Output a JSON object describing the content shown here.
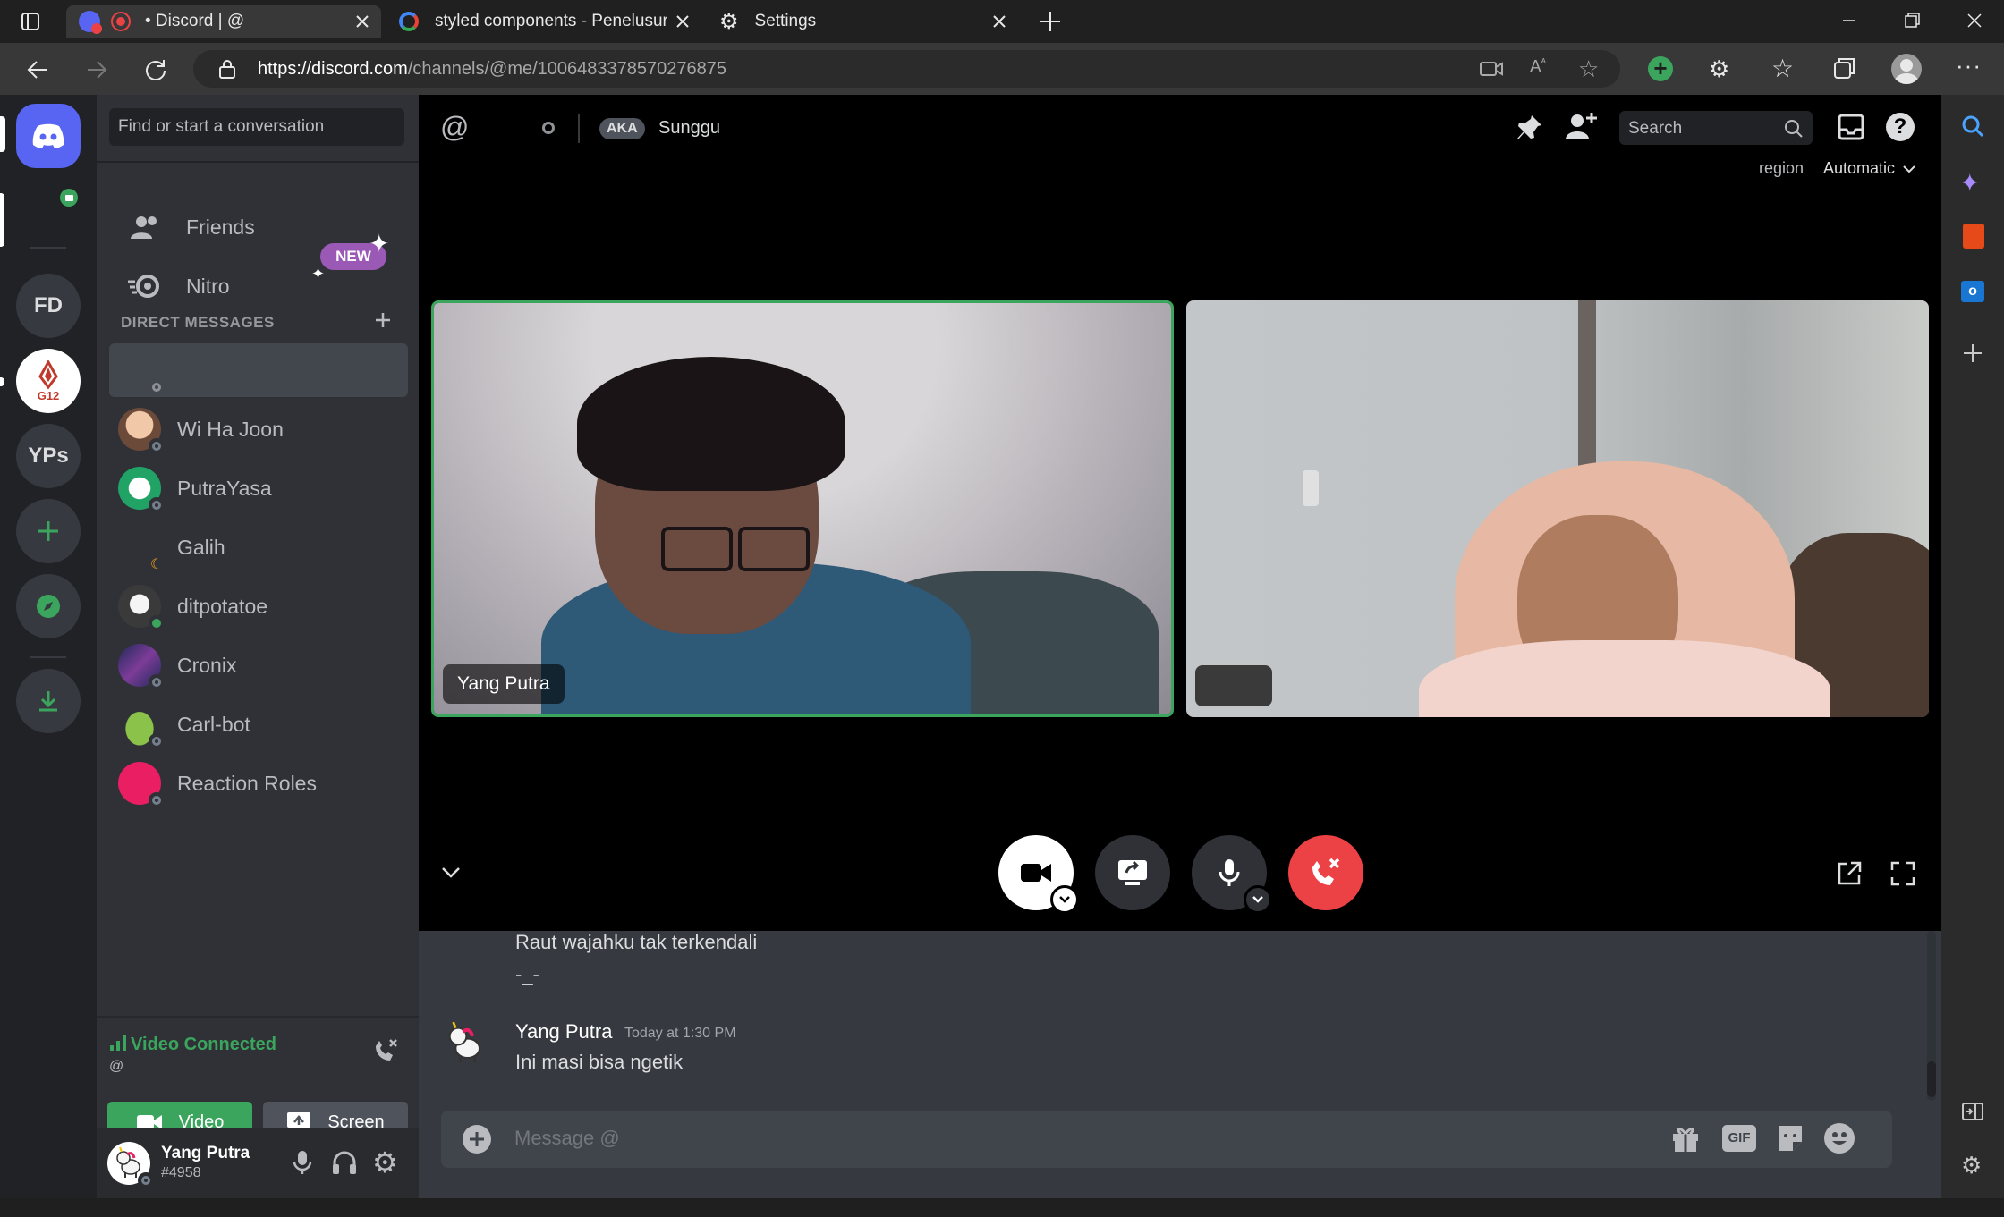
{
  "browser": {
    "tabs": [
      {
        "label": "• Discord | @",
        "active": true
      },
      {
        "label": "styled components - Penelusuran",
        "active": false
      },
      {
        "label": "Settings",
        "active": false
      }
    ],
    "url_host": "https://discord.com",
    "url_path": "/channels/@me/1006483378570276875"
  },
  "guilds": {
    "items": [
      {
        "label": "FD"
      },
      {
        "label": "G12"
      },
      {
        "label": "YPs"
      }
    ]
  },
  "dm": {
    "search_placeholder": "Find or start a conversation",
    "friends": "Friends",
    "nitro": "Nitro",
    "nitro_badge": "NEW",
    "header": "DIRECT MESSAGES",
    "items": [
      {
        "name": ""
      },
      {
        "name": "Wi Ha Joon"
      },
      {
        "name": "PutraYasa"
      },
      {
        "name": "Galih"
      },
      {
        "name": "ditpotatoe"
      },
      {
        "name": "Cronix"
      },
      {
        "name": "Carl-bot"
      },
      {
        "name": "Reaction Roles"
      }
    ]
  },
  "voice": {
    "status": "Video Connected",
    "channel": "@",
    "video_label": "Video",
    "screen_label": "Screen"
  },
  "user": {
    "name": "Yang Putra",
    "tag": "#4958"
  },
  "call": {
    "aka_badge": "AKA",
    "aka_name": "Sunggu",
    "search_placeholder": "Search",
    "region_label": "region",
    "region_value": "Automatic",
    "tile1_name": "Yang Putra",
    "tile2_name": ""
  },
  "chat": {
    "prev_lines": [
      "Raut wajahku tak terkendali",
      "-_-"
    ],
    "author": "Yang Putra",
    "timestamp": "Today at 1:30 PM",
    "message": "Ini masi bisa ngetik",
    "composer_placeholder": "Message @",
    "gif_label": "GIF"
  },
  "colors": {
    "blurple": "#5865f2",
    "green": "#3ba55d",
    "red": "#ed4245",
    "nitro_purple": "#9b59b6"
  }
}
